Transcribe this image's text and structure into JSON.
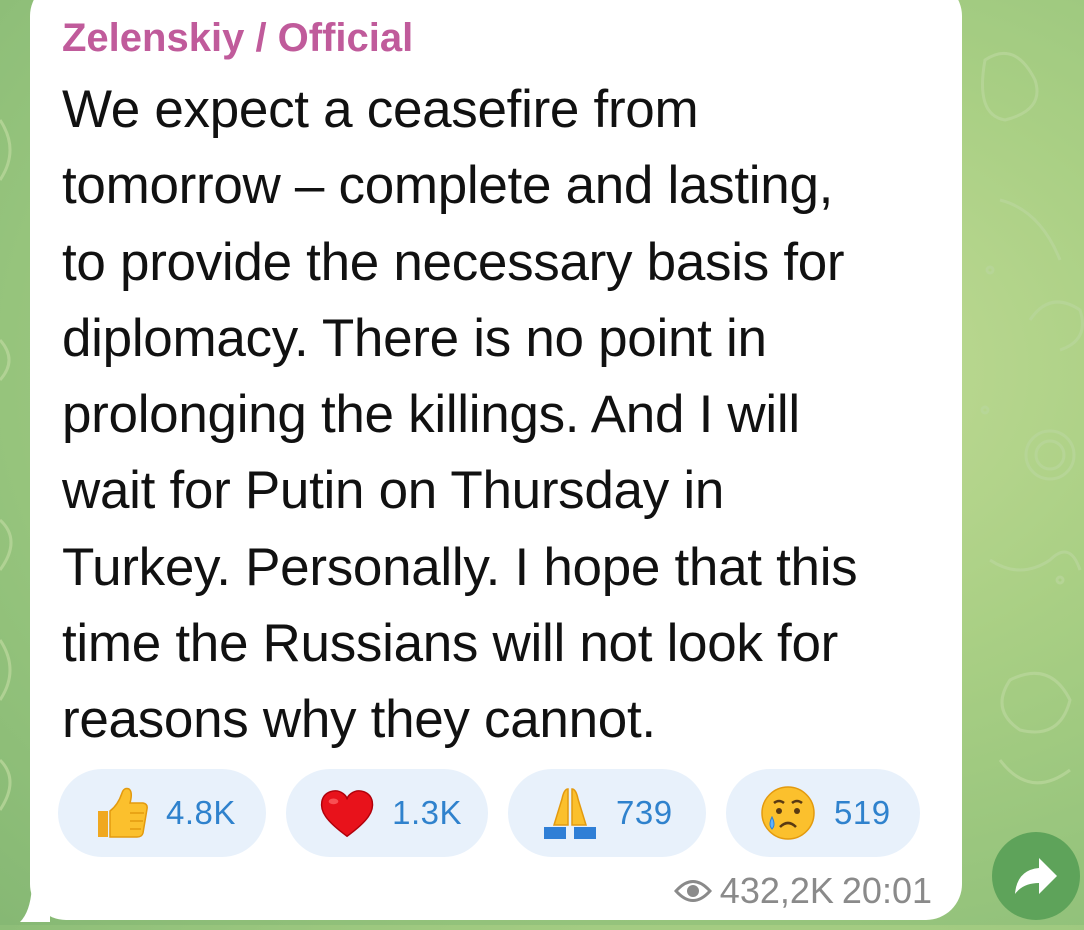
{
  "channel": {
    "name": "Zelenskiy / Official"
  },
  "message": {
    "lines": [
      "We expect a ceasefire from",
      "tomorrow – complete and lasting,",
      "to provide the necessary basis for",
      "diplomacy. There is no point in",
      "prolonging the killings. And I will",
      "wait for Putin on Thursday in",
      "Turkey. Personally. I hope that this",
      "time the Russians will not look for",
      "reasons why they cannot."
    ]
  },
  "reactions": [
    {
      "icon": "thumbs-up-emoji",
      "count": "4.8K"
    },
    {
      "icon": "red-heart-emoji",
      "count": "1.3K"
    },
    {
      "icon": "folded-hands-emoji",
      "count": "739"
    },
    {
      "icon": "crying-face-emoji",
      "count": "519"
    }
  ],
  "meta": {
    "views": "432,2K",
    "time": "20:01"
  },
  "colors": {
    "sender": "#c05b9b",
    "reaction_bg": "#e8f1fb",
    "reaction_text": "#2f82cd",
    "share_button": "#5ea35a",
    "meta_text": "#8a8a8a"
  }
}
